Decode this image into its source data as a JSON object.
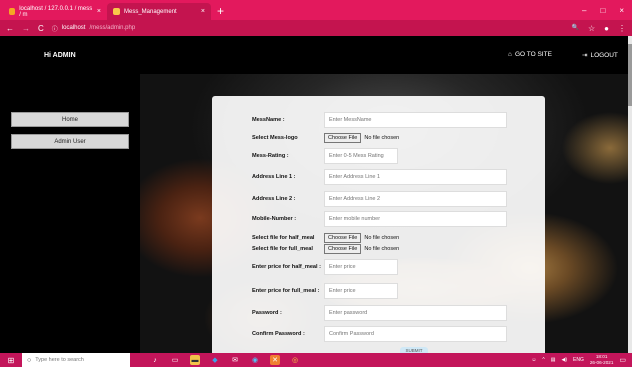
{
  "browser": {
    "tabs": [
      {
        "title": "localhost / 127.0.0.1 / mess / m",
        "close": "×"
      },
      {
        "title": "Mess_Management",
        "close": "×"
      }
    ],
    "new_tab": "+",
    "window_controls": {
      "minimize": "–",
      "maximize": "□",
      "close": "×"
    },
    "nav": {
      "back": "←",
      "forward": "→",
      "reload": "C",
      "info": "ⓘ"
    },
    "url_host": "localhost",
    "url_path": "/mess/admin.php",
    "right_icons": {
      "search": "🔍",
      "star": "☆",
      "profile": "●",
      "menu": "⋮"
    }
  },
  "header": {
    "brand": "Hi ADMIN",
    "go_to_site": "GO TO SITE",
    "logout": "LOGOUT"
  },
  "sidebar": {
    "items": [
      {
        "label": "Home"
      },
      {
        "label": "Admin User"
      }
    ]
  },
  "form": {
    "mess_name": {
      "label": "MessName :",
      "placeholder": "Enter MessName"
    },
    "mess_logo": {
      "label": "Select Mess-logo",
      "button": "Choose File",
      "status": "No file chosen"
    },
    "mess_rating": {
      "label": "Mess-Rating :",
      "placeholder": "Enter 0-5 Mess Rating"
    },
    "address1": {
      "label": "Address Line 1 :",
      "placeholder": "Enter Address Line 1"
    },
    "address2": {
      "label": "Address Line 2 :",
      "placeholder": "Enter Address Line 2"
    },
    "mobile": {
      "label": "Mobile-Number :",
      "placeholder": "Enter mobile number"
    },
    "half_meal_file": {
      "label": "Select file for half_meal",
      "button": "Choose File",
      "status": "No file chosen"
    },
    "full_meal_file": {
      "label": "Select file for full_meal",
      "button": "Choose File",
      "status": "No file chosen"
    },
    "half_price": {
      "label": "Enter price for half_meal :",
      "placeholder": "Enter price"
    },
    "full_price": {
      "label": "Enter price for full_meal :",
      "placeholder": "Enter price"
    },
    "password": {
      "label": "Password :",
      "placeholder": "Enter password"
    },
    "confirm_password": {
      "label": "Confirm Password :",
      "placeholder": "Confirm Password"
    },
    "submit": "SUBMIT"
  },
  "taskbar": {
    "search_placeholder": "Type here to search",
    "language": "ENG",
    "time": "18:01",
    "date": "26-06-2021"
  },
  "colors": {
    "browser_accent": "#e3195d",
    "taskbar": "#c3155a"
  }
}
